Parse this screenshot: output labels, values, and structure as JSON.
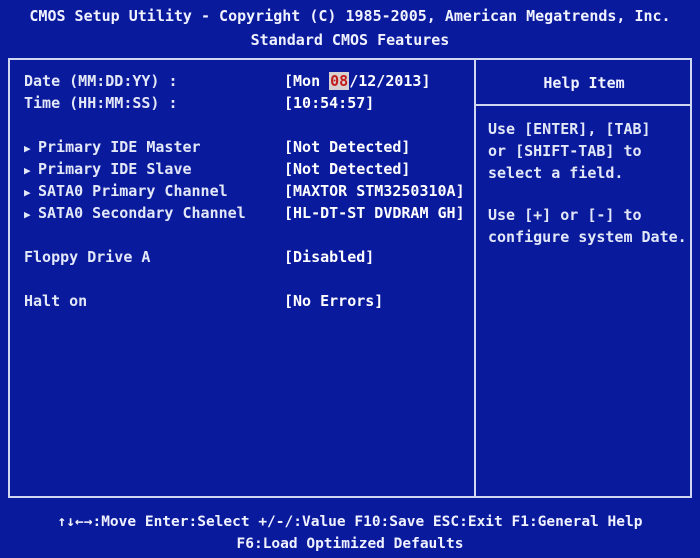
{
  "header": {
    "title": "CMOS Setup Utility - Copyright (C) 1985-2005, American Megatrends, Inc.",
    "subtitle": "Standard CMOS Features"
  },
  "settings": {
    "date": {
      "label": "Date (MM:DD:YY) :",
      "prefix": "[Mon ",
      "selected": "08",
      "suffix": "/12/2013]"
    },
    "time": {
      "label": "Time (HH:MM:SS) :",
      "value": "[10:54:57]"
    },
    "primary_ide_master": {
      "label": "Primary IDE Master",
      "value": "[Not Detected]"
    },
    "primary_ide_slave": {
      "label": "Primary IDE Slave",
      "value": "[Not Detected]"
    },
    "sata0_primary": {
      "label": "SATA0 Primary Channel",
      "value": "[MAXTOR STM3250310A]"
    },
    "sata0_secondary": {
      "label": "SATA0 Secondary Channel",
      "value": "[HL-DT-ST DVDRAM GH]"
    },
    "floppy": {
      "label": "Floppy Drive A",
      "value": "[Disabled]"
    },
    "halt": {
      "label": "Halt on",
      "value": "[No Errors]"
    }
  },
  "help": {
    "title": "Help Item",
    "lines": [
      "Use [ENTER], [TAB]",
      "or [SHIFT-TAB] to",
      "select a field.",
      "Use [+] or [-] to",
      "configure system Date."
    ]
  },
  "footer": {
    "line1": "↑↓←→:Move  Enter:Select  +/-/:Value  F10:Save  ESC:Exit  F1:General Help",
    "line2": "F6:Load Optimized Defaults"
  },
  "icons": {
    "submenu_arrow": "▶"
  },
  "colors": {
    "background": "#0a1a9c",
    "text": "#e3e8f8",
    "highlight_bg": "#d8d0d0",
    "highlight_fg": "#c21b1b"
  }
}
